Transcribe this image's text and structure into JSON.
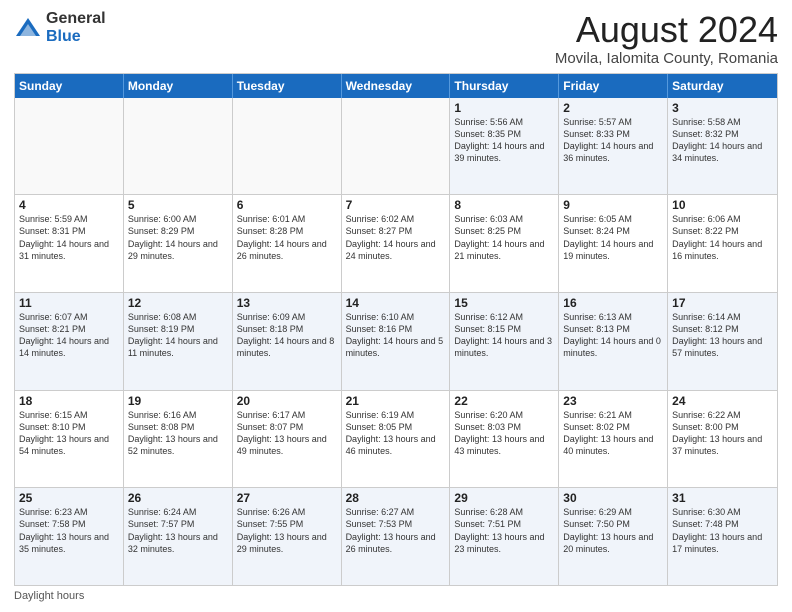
{
  "logo": {
    "general": "General",
    "blue": "Blue"
  },
  "title": "August 2024",
  "subtitle": "Movila, Ialomita County, Romania",
  "days": [
    "Sunday",
    "Monday",
    "Tuesday",
    "Wednesday",
    "Thursday",
    "Friday",
    "Saturday"
  ],
  "footer_label": "Daylight hours",
  "rows": [
    [
      {
        "num": "",
        "text": ""
      },
      {
        "num": "",
        "text": ""
      },
      {
        "num": "",
        "text": ""
      },
      {
        "num": "",
        "text": ""
      },
      {
        "num": "1",
        "text": "Sunrise: 5:56 AM\nSunset: 8:35 PM\nDaylight: 14 hours and 39 minutes."
      },
      {
        "num": "2",
        "text": "Sunrise: 5:57 AM\nSunset: 8:33 PM\nDaylight: 14 hours and 36 minutes."
      },
      {
        "num": "3",
        "text": "Sunrise: 5:58 AM\nSunset: 8:32 PM\nDaylight: 14 hours and 34 minutes."
      }
    ],
    [
      {
        "num": "4",
        "text": "Sunrise: 5:59 AM\nSunset: 8:31 PM\nDaylight: 14 hours and 31 minutes."
      },
      {
        "num": "5",
        "text": "Sunrise: 6:00 AM\nSunset: 8:29 PM\nDaylight: 14 hours and 29 minutes."
      },
      {
        "num": "6",
        "text": "Sunrise: 6:01 AM\nSunset: 8:28 PM\nDaylight: 14 hours and 26 minutes."
      },
      {
        "num": "7",
        "text": "Sunrise: 6:02 AM\nSunset: 8:27 PM\nDaylight: 14 hours and 24 minutes."
      },
      {
        "num": "8",
        "text": "Sunrise: 6:03 AM\nSunset: 8:25 PM\nDaylight: 14 hours and 21 minutes."
      },
      {
        "num": "9",
        "text": "Sunrise: 6:05 AM\nSunset: 8:24 PM\nDaylight: 14 hours and 19 minutes."
      },
      {
        "num": "10",
        "text": "Sunrise: 6:06 AM\nSunset: 8:22 PM\nDaylight: 14 hours and 16 minutes."
      }
    ],
    [
      {
        "num": "11",
        "text": "Sunrise: 6:07 AM\nSunset: 8:21 PM\nDaylight: 14 hours and 14 minutes."
      },
      {
        "num": "12",
        "text": "Sunrise: 6:08 AM\nSunset: 8:19 PM\nDaylight: 14 hours and 11 minutes."
      },
      {
        "num": "13",
        "text": "Sunrise: 6:09 AM\nSunset: 8:18 PM\nDaylight: 14 hours and 8 minutes."
      },
      {
        "num": "14",
        "text": "Sunrise: 6:10 AM\nSunset: 8:16 PM\nDaylight: 14 hours and 5 minutes."
      },
      {
        "num": "15",
        "text": "Sunrise: 6:12 AM\nSunset: 8:15 PM\nDaylight: 14 hours and 3 minutes."
      },
      {
        "num": "16",
        "text": "Sunrise: 6:13 AM\nSunset: 8:13 PM\nDaylight: 14 hours and 0 minutes."
      },
      {
        "num": "17",
        "text": "Sunrise: 6:14 AM\nSunset: 8:12 PM\nDaylight: 13 hours and 57 minutes."
      }
    ],
    [
      {
        "num": "18",
        "text": "Sunrise: 6:15 AM\nSunset: 8:10 PM\nDaylight: 13 hours and 54 minutes."
      },
      {
        "num": "19",
        "text": "Sunrise: 6:16 AM\nSunset: 8:08 PM\nDaylight: 13 hours and 52 minutes."
      },
      {
        "num": "20",
        "text": "Sunrise: 6:17 AM\nSunset: 8:07 PM\nDaylight: 13 hours and 49 minutes."
      },
      {
        "num": "21",
        "text": "Sunrise: 6:19 AM\nSunset: 8:05 PM\nDaylight: 13 hours and 46 minutes."
      },
      {
        "num": "22",
        "text": "Sunrise: 6:20 AM\nSunset: 8:03 PM\nDaylight: 13 hours and 43 minutes."
      },
      {
        "num": "23",
        "text": "Sunrise: 6:21 AM\nSunset: 8:02 PM\nDaylight: 13 hours and 40 minutes."
      },
      {
        "num": "24",
        "text": "Sunrise: 6:22 AM\nSunset: 8:00 PM\nDaylight: 13 hours and 37 minutes."
      }
    ],
    [
      {
        "num": "25",
        "text": "Sunrise: 6:23 AM\nSunset: 7:58 PM\nDaylight: 13 hours and 35 minutes."
      },
      {
        "num": "26",
        "text": "Sunrise: 6:24 AM\nSunset: 7:57 PM\nDaylight: 13 hours and 32 minutes."
      },
      {
        "num": "27",
        "text": "Sunrise: 6:26 AM\nSunset: 7:55 PM\nDaylight: 13 hours and 29 minutes."
      },
      {
        "num": "28",
        "text": "Sunrise: 6:27 AM\nSunset: 7:53 PM\nDaylight: 13 hours and 26 minutes."
      },
      {
        "num": "29",
        "text": "Sunrise: 6:28 AM\nSunset: 7:51 PM\nDaylight: 13 hours and 23 minutes."
      },
      {
        "num": "30",
        "text": "Sunrise: 6:29 AM\nSunset: 7:50 PM\nDaylight: 13 hours and 20 minutes."
      },
      {
        "num": "31",
        "text": "Sunrise: 6:30 AM\nSunset: 7:48 PM\nDaylight: 13 hours and 17 minutes."
      }
    ]
  ],
  "alt_rows": [
    0,
    2,
    4
  ]
}
